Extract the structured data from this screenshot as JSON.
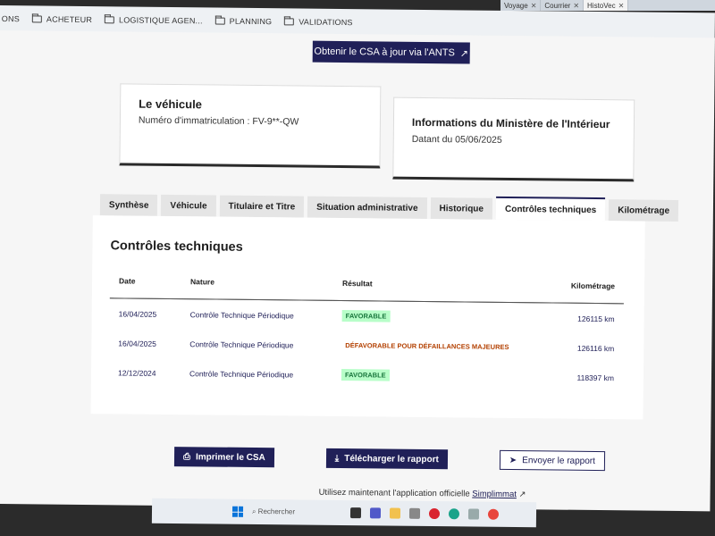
{
  "browser": {
    "tabs": [
      {
        "label": "Voyage",
        "active": false
      },
      {
        "label": "Courrier",
        "active": false
      },
      {
        "label": "HistoVec",
        "active": true
      }
    ],
    "bookmarks": [
      "ONS",
      "ACHETEUR",
      "LOGISTIQUE AGEN...",
      "PLANNING",
      "VALIDATIONS"
    ]
  },
  "header": {
    "csa_button": "Obtenir le CSA à jour via l'ANTS"
  },
  "vehicle_card": {
    "title": "Le véhicule",
    "plate": "Numéro d'immatriculation : FV-9**-QW"
  },
  "ministry_card": {
    "title": "Informations du Ministère de l'Intérieur",
    "date": "Datant du 05/06/2025"
  },
  "tabs": [
    "Synthèse",
    "Véhicule",
    "Titulaire et Titre",
    "Situation administrative",
    "Historique",
    "Contrôles techniques",
    "Kilométrage"
  ],
  "active_tab": "Contrôles techniques",
  "controls": {
    "title": "Contrôles techniques",
    "headers": {
      "date": "Date",
      "nature": "Nature",
      "result": "Résultat",
      "km": "Kilométrage"
    },
    "rows": [
      {
        "date": "16/04/2025",
        "nature": "Contrôle Technique Périodique",
        "result": "FAVORABLE",
        "status": "ok",
        "km": "126115 km"
      },
      {
        "date": "16/04/2025",
        "nature": "Contrôle Technique Périodique",
        "result": "DÉFAVORABLE POUR DÉFAILLANCES MAJEURES",
        "status": "ko",
        "km": "126116 km"
      },
      {
        "date": "12/12/2024",
        "nature": "Contrôle Technique Périodique",
        "result": "FAVORABLE",
        "status": "ok",
        "km": "118397 km"
      }
    ]
  },
  "actions": {
    "print": "Imprimer le CSA",
    "download": "Télécharger le rapport",
    "send": "Envoyer le rapport"
  },
  "footer_note": {
    "text": "Utilisez maintenant l'application officielle ",
    "link": "Simplimmat"
  },
  "taskbar": {
    "search_placeholder": "Rechercher"
  },
  "colors": {
    "primary": "#202058",
    "success_bg": "#b8fec9",
    "success_fg": "#18753c",
    "error_fg": "#b34000"
  }
}
